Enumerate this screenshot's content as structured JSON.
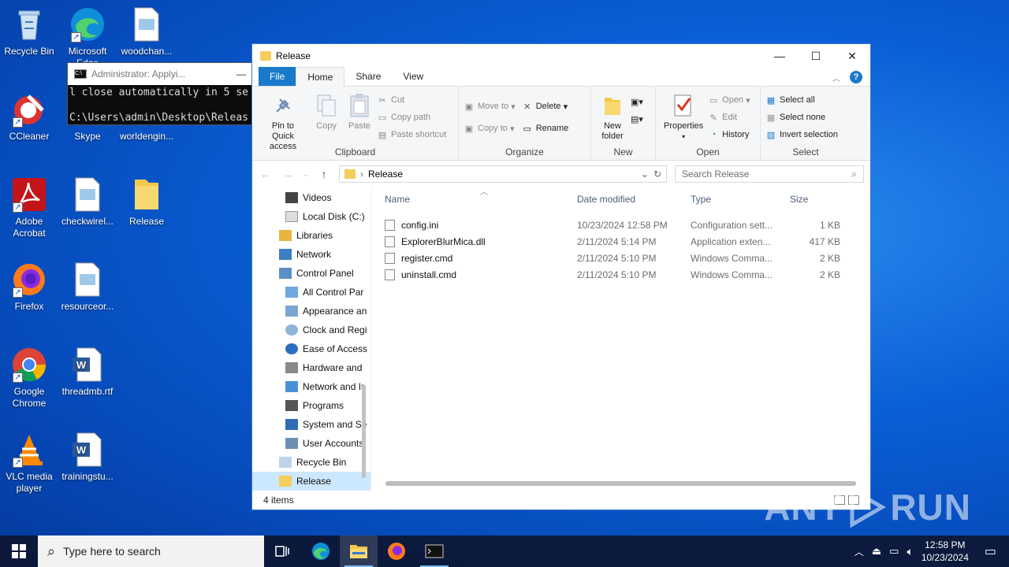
{
  "desktop": {
    "icons": [
      {
        "label": "Recycle Bin"
      },
      {
        "label": "Microsoft Edge"
      },
      {
        "label": "woodchan..."
      },
      {
        "label": "CCleaner"
      },
      {
        "label": "Skype"
      },
      {
        "label": "worldengin..."
      },
      {
        "label": "Adobe Acrobat"
      },
      {
        "label": "checkwirel..."
      },
      {
        "label": "Release"
      },
      {
        "label": "Firefox"
      },
      {
        "label": "resourceor..."
      },
      {
        "label": "Google Chrome"
      },
      {
        "label": "threadmb.rtf"
      },
      {
        "label": "VLC media player"
      },
      {
        "label": "trainingstu..."
      }
    ]
  },
  "console": {
    "title": "Administrator: Applyi...",
    "line1": "l close automatically in 5 se",
    "line2": "C:\\Users\\admin\\Desktop\\Releas"
  },
  "explorer": {
    "title": "Release",
    "tabs": [
      "File",
      "Home",
      "Share",
      "View"
    ],
    "ribbon": {
      "clipboard": {
        "label": "Clipboard",
        "pin": "Pin to Quick access",
        "copy": "Copy",
        "paste": "Paste",
        "cut": "Cut",
        "copy_path": "Copy path",
        "paste_shortcut": "Paste shortcut"
      },
      "organize": {
        "label": "Organize",
        "move_to": "Move to",
        "copy_to": "Copy to",
        "delete": "Delete",
        "rename": "Rename"
      },
      "new": {
        "label": "New",
        "new_folder": "New folder"
      },
      "open": {
        "label": "Open",
        "properties": "Properties",
        "open": "Open",
        "edit": "Edit",
        "history": "History"
      },
      "select": {
        "label": "Select",
        "select_all": "Select all",
        "select_none": "Select none",
        "invert": "Invert selection"
      }
    },
    "address": {
      "path": "Release",
      "search_placeholder": "Search Release"
    },
    "nav": [
      {
        "label": "Videos"
      },
      {
        "label": "Local Disk (C:)"
      },
      {
        "label": "Libraries"
      },
      {
        "label": "Network"
      },
      {
        "label": "Control Panel"
      },
      {
        "label": "All Control Par"
      },
      {
        "label": "Appearance an"
      },
      {
        "label": "Clock and Regi"
      },
      {
        "label": "Ease of Access"
      },
      {
        "label": "Hardware and"
      },
      {
        "label": "Network and Ir"
      },
      {
        "label": "Programs"
      },
      {
        "label": "System and Se"
      },
      {
        "label": "User Accounts"
      },
      {
        "label": "Recycle Bin"
      },
      {
        "label": "Release"
      }
    ],
    "columns": {
      "name": "Name",
      "date": "Date modified",
      "type": "Type",
      "size": "Size"
    },
    "files": [
      {
        "name": "config.ini",
        "date": "10/23/2024 12:58 PM",
        "type": "Configuration sett...",
        "size": "1 KB"
      },
      {
        "name": "ExplorerBlurMica.dll",
        "date": "2/11/2024 5:14 PM",
        "type": "Application exten...",
        "size": "417 KB"
      },
      {
        "name": "register.cmd",
        "date": "2/11/2024 5:10 PM",
        "type": "Windows Comma...",
        "size": "2 KB"
      },
      {
        "name": "uninstall.cmd",
        "date": "2/11/2024 5:10 PM",
        "type": "Windows Comma...",
        "size": "2 KB"
      }
    ],
    "status": "4 items"
  },
  "taskbar": {
    "search_placeholder": "Type here to search",
    "time": "12:58 PM",
    "date": "10/23/2024"
  },
  "watermark": {
    "text_a": "ANY",
    "text_b": "RUN"
  }
}
